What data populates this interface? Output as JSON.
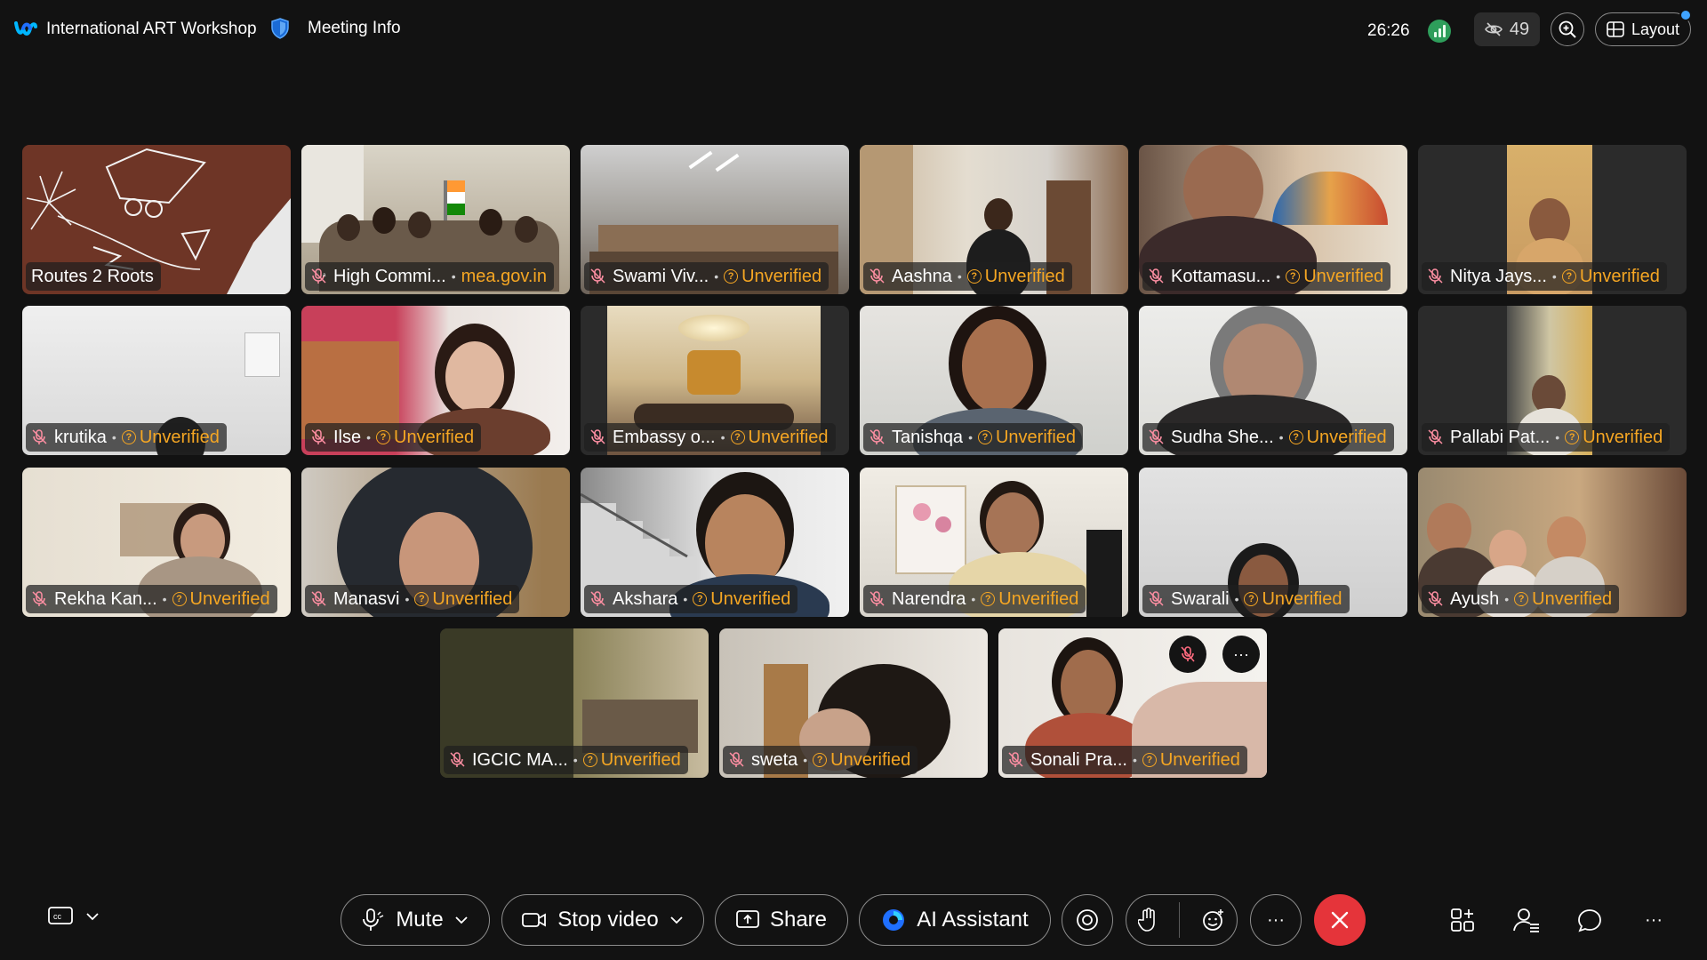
{
  "header": {
    "title": "International ART Workshop",
    "meeting_info": "Meeting Info",
    "timer": "26:26",
    "viewer_count": "49",
    "layout_label": "Layout"
  },
  "participants": [
    {
      "name": "Routes 2 Roots",
      "status": ""
    },
    {
      "name": "High Commi...",
      "status": "mea.gov.in"
    },
    {
      "name": "Swami Viv...",
      "status": "Unverified"
    },
    {
      "name": "Aashna",
      "status": "Unverified"
    },
    {
      "name": "Kottamasu...",
      "status": "Unverified"
    },
    {
      "name": "Nitya Jays...",
      "status": "Unverified"
    },
    {
      "name": "krutika",
      "status": "Unverified"
    },
    {
      "name": "Ilse",
      "status": "Unverified"
    },
    {
      "name": "Embassy o...",
      "status": "Unverified"
    },
    {
      "name": "Tanishqa",
      "status": "Unverified"
    },
    {
      "name": "Sudha She...",
      "status": "Unverified"
    },
    {
      "name": "Pallabi Pat...",
      "status": "Unverified"
    },
    {
      "name": "Rekha Kan...",
      "status": "Unverified"
    },
    {
      "name": "Manasvi",
      "status": "Unverified"
    },
    {
      "name": "Akshara",
      "status": "Unverified"
    },
    {
      "name": "Narendra",
      "status": "Unverified"
    },
    {
      "name": "Swarali",
      "status": "Unverified"
    },
    {
      "name": "Ayush",
      "status": "Unverified"
    },
    {
      "name": "IGCIC MA...",
      "status": "Unverified"
    },
    {
      "name": "sweta",
      "status": "Unverified"
    },
    {
      "name": "Sonali Pra...",
      "status": "Unverified"
    }
  ],
  "controls": {
    "mute": "Mute",
    "stop_video": "Stop video",
    "share": "Share",
    "ai_assistant": "AI Assistant"
  },
  "tile_more": "···",
  "more_options": "···",
  "side_more": "···",
  "colors": {
    "background": "#121212",
    "unverified": "#f5a623",
    "end_call": "#e5343a",
    "accent": "#3fa3ff"
  }
}
